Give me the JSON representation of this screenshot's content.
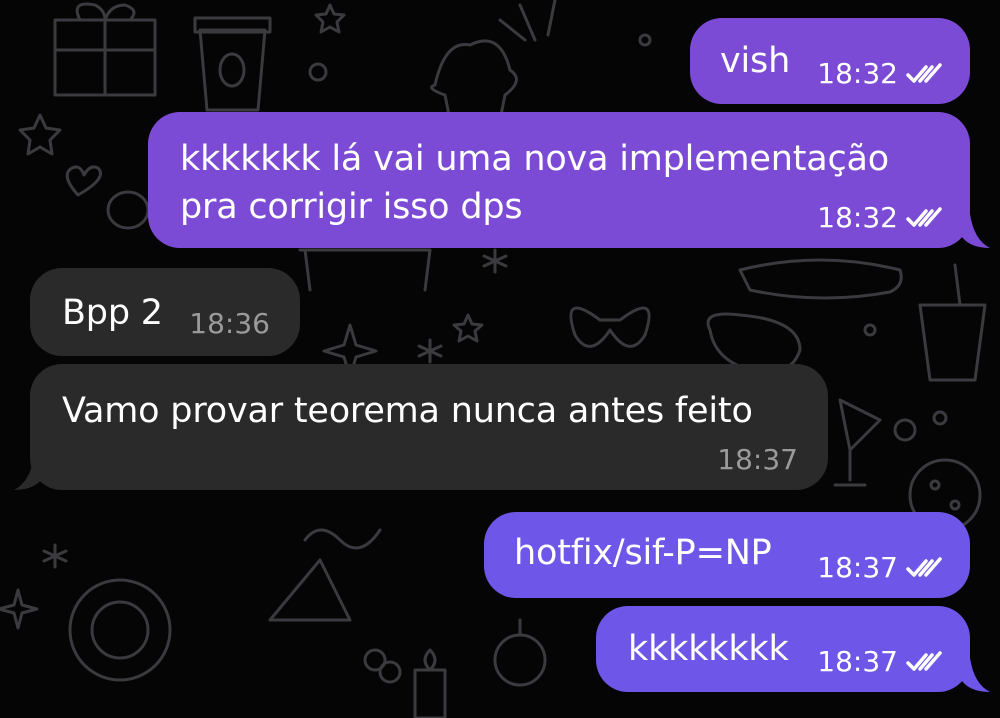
{
  "colors": {
    "outgoing_bubble": "#7B4BD6",
    "outgoing_bubble_alt": "#6E56E8",
    "incoming_bubble": "#2A2A2A",
    "background": "#050505"
  },
  "messages": [
    {
      "direction": "outgoing",
      "text": "vish",
      "time": "18:32",
      "status": "read"
    },
    {
      "direction": "outgoing",
      "text_lines": [
        "kkkkkkk lá vai uma nova implementação",
        "pra corrigir isso dps"
      ],
      "time": "18:32",
      "status": "read"
    },
    {
      "direction": "incoming",
      "text": "Bpp 2",
      "time": "18:36"
    },
    {
      "direction": "incoming",
      "text": "Vamo provar teorema nunca antes feito",
      "time": "18:37"
    },
    {
      "direction": "outgoing",
      "text": "hotfix/sif-P=NP",
      "time": "18:37",
      "status": "read"
    },
    {
      "direction": "outgoing",
      "text": "kkkkkkkk",
      "time": "18:37",
      "status": "read"
    }
  ],
  "icons": {
    "read_receipt": "double-check-icon",
    "background_pattern": "doodle-pattern"
  }
}
